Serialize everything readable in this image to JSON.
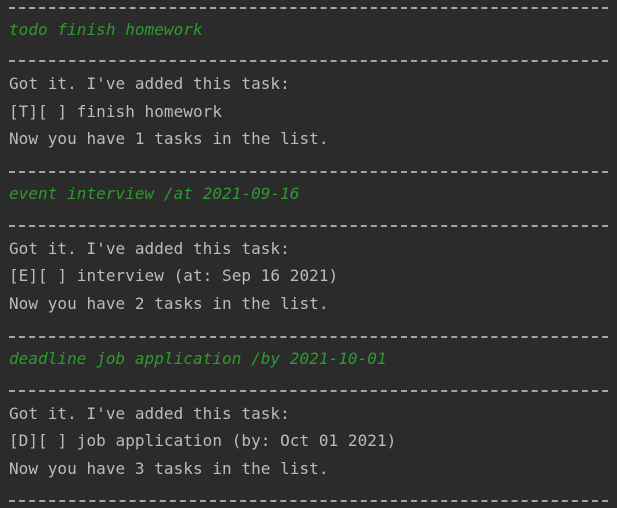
{
  "colors": {
    "background": "#2b2b2b",
    "output_text": "#bbbbbb",
    "user_input_text": "#2f9a2f"
  },
  "console": {
    "blocks": [
      {
        "command": "todo finish homework",
        "ack": "Got it. I've added this task:",
        "task": "[T][ ] finish homework",
        "count": "Now you have 1 tasks in the list."
      },
      {
        "command": "event interview /at 2021-09-16",
        "ack": "Got it. I've added this task:",
        "task": "[E][ ] interview (at: Sep 16 2021)",
        "count": "Now you have 2 tasks in the list."
      },
      {
        "command": "deadline job application /by 2021-10-01",
        "ack": "Got it. I've added this task:",
        "task": "[D][ ] job application (by: Oct 01 2021)",
        "count": "Now you have 3 tasks in the list."
      }
    ]
  }
}
